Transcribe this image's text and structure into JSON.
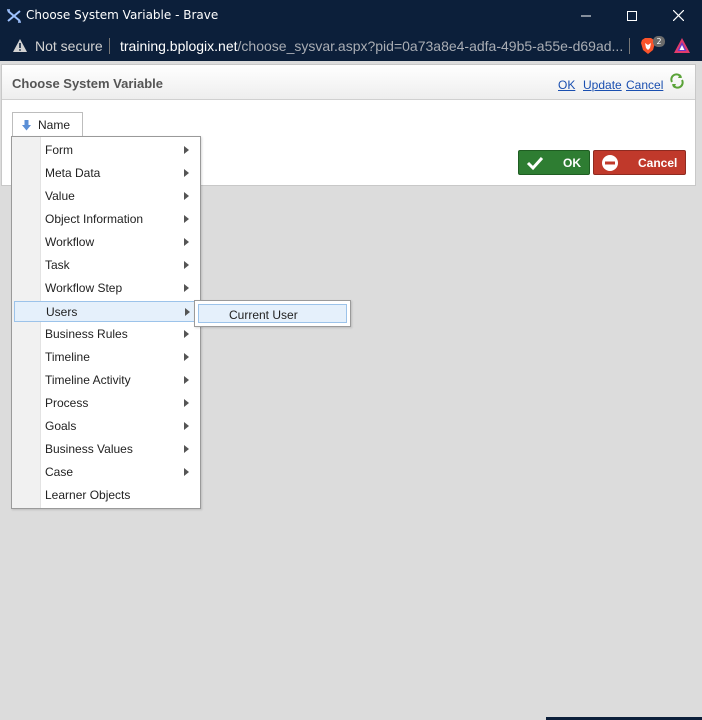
{
  "window": {
    "title": "Choose System Variable - Brave",
    "colors": {
      "titlebar": "#0c1f3a"
    }
  },
  "address": {
    "security_label": "Not secure",
    "url_host": "training.bplogix.net",
    "url_rest": "/choose_sysvar.aspx?pid=0a73a8e4-adfa-49b5-a55e-d69ad...",
    "shields_count": "2"
  },
  "panel": {
    "title": "Choose System Variable",
    "links": {
      "ok": "OK",
      "update": "Update",
      "cancel": "Cancel"
    },
    "sort_button_label": "Name",
    "ok_button_label": "OK",
    "cancel_button_label": "Cancel",
    "colors": {
      "ok": "#2e7d32",
      "cancel": "#c0392b",
      "link": "#1a4fb0"
    }
  },
  "menu": {
    "items": [
      {
        "label": "Form",
        "has_submenu": true
      },
      {
        "label": "Meta Data",
        "has_submenu": true
      },
      {
        "label": "Value",
        "has_submenu": true
      },
      {
        "label": "Object Information",
        "has_submenu": true
      },
      {
        "label": "Workflow",
        "has_submenu": true
      },
      {
        "label": "Task",
        "has_submenu": true
      },
      {
        "label": "Workflow Step",
        "has_submenu": true
      },
      {
        "label": "Users",
        "has_submenu": true,
        "active": true
      },
      {
        "label": "Business Rules",
        "has_submenu": true
      },
      {
        "label": "Timeline",
        "has_submenu": true
      },
      {
        "label": "Timeline Activity",
        "has_submenu": true
      },
      {
        "label": "Process",
        "has_submenu": true
      },
      {
        "label": "Goals",
        "has_submenu": true
      },
      {
        "label": "Business Values",
        "has_submenu": true
      },
      {
        "label": "Case",
        "has_submenu": true
      },
      {
        "label": "Learner Objects",
        "has_submenu": false
      }
    ],
    "submenu": {
      "items": [
        {
          "label": "Current User"
        }
      ]
    }
  }
}
